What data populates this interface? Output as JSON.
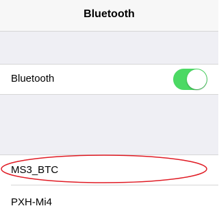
{
  "nav": {
    "title": "Bluetooth"
  },
  "settings": {
    "bluetooth_label": "Bluetooth",
    "bluetooth_enabled": true
  },
  "devices": [
    {
      "name": "MS3_BTC",
      "highlighted": true
    },
    {
      "name": "PXH-Mi4",
      "highlighted": false
    }
  ],
  "colors": {
    "toggle_on": "#4cd964",
    "annotation": "#e01b24",
    "group_background": "#efeff4",
    "nav_background": "#f7f7f7"
  }
}
